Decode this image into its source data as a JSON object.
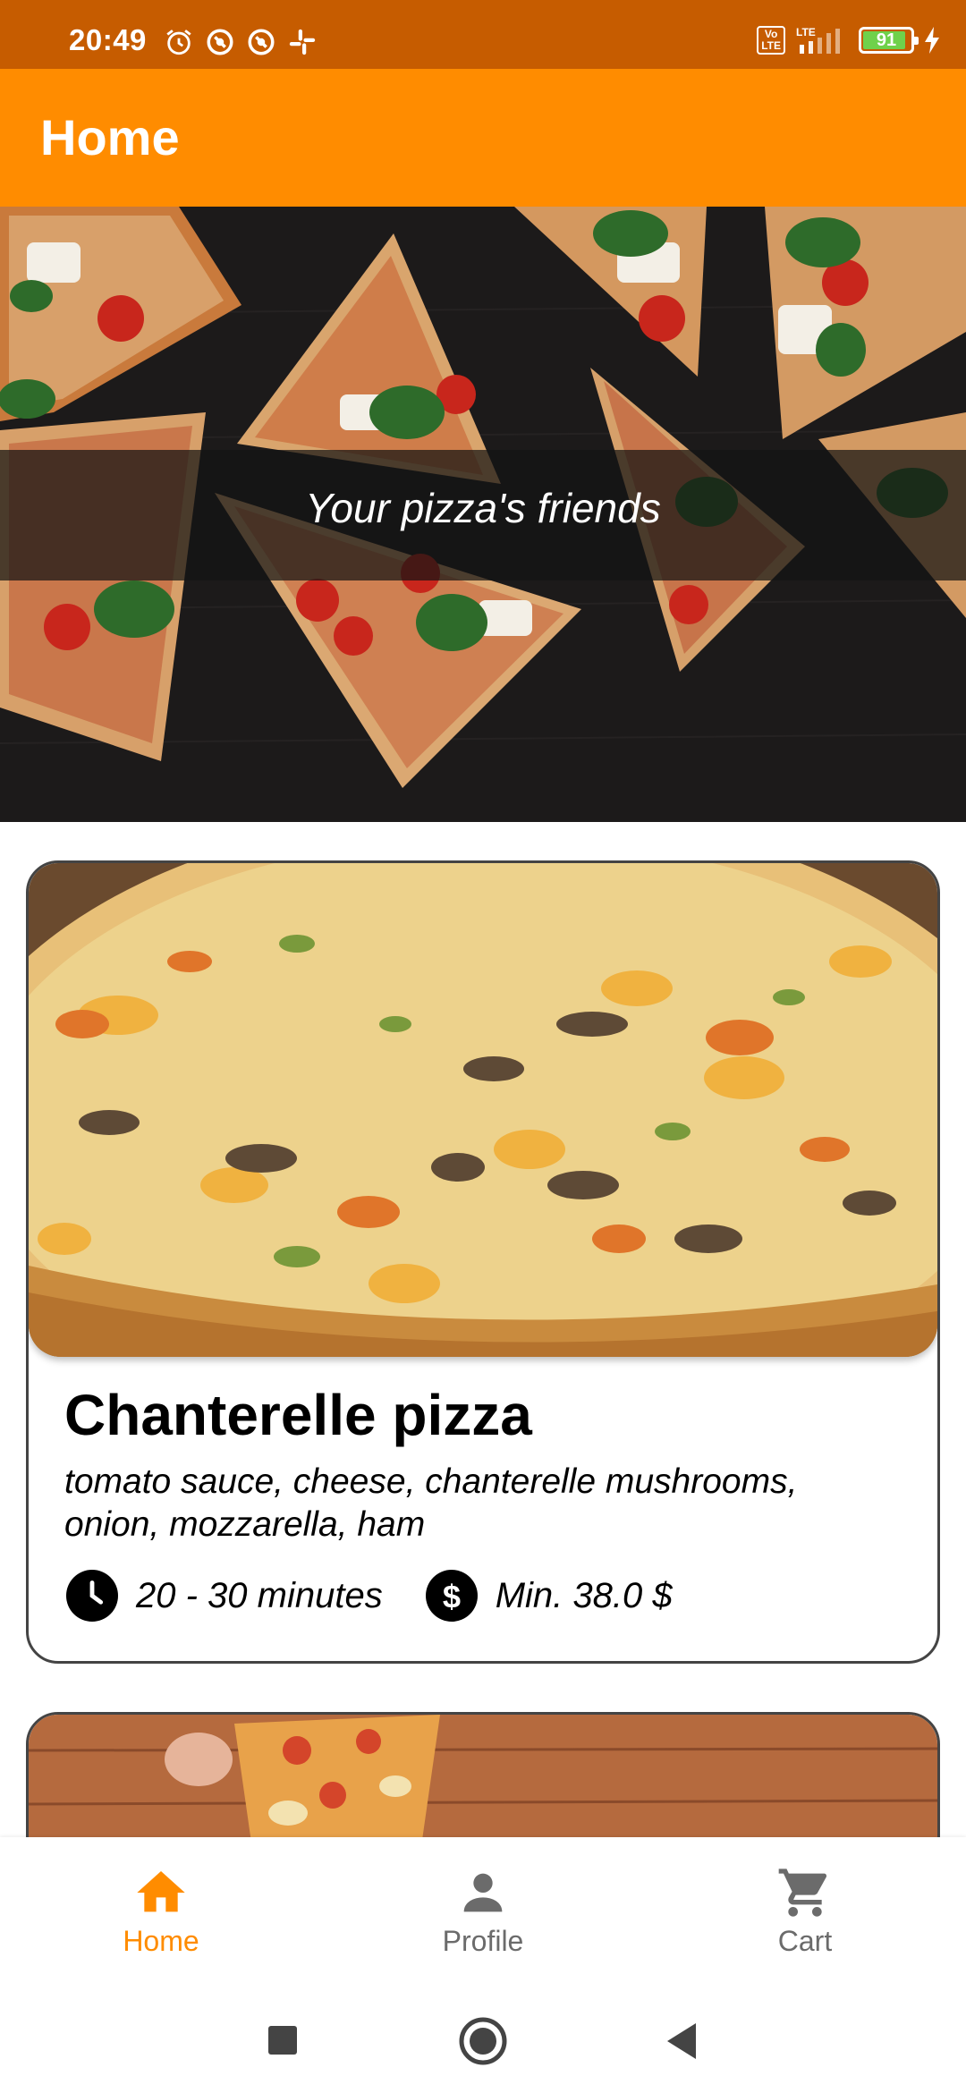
{
  "status_bar": {
    "time": "20:49",
    "left_icons": [
      "alarm-icon",
      "app-notification-icon",
      "app-notification-icon",
      "slack-icon"
    ],
    "network": "LTE",
    "volte": "Vo\nLTE",
    "battery": "91",
    "battery_level": 0.91
  },
  "app_bar": {
    "title": "Home"
  },
  "hero": {
    "tagline": "Your pizza's friends"
  },
  "cards": [
    {
      "title": "Chanterelle pizza",
      "description": "tomato sauce, cheese, chanterelle mushrooms, onion, mozzarella, ham",
      "time_icon": "clock-icon",
      "time": "20 - 30 minutes",
      "price_icon": "dollar-icon",
      "price": "Min. 38.0 $"
    }
  ],
  "bottom_nav": {
    "items": [
      {
        "label": "Home",
        "icon": "home-icon",
        "active": true
      },
      {
        "label": "Profile",
        "icon": "person-icon",
        "active": false
      },
      {
        "label": "Cart",
        "icon": "cart-icon",
        "active": false
      }
    ]
  },
  "colors": {
    "status_bar": "#c65c00",
    "primary": "#ff8c00",
    "inactive": "#6b6b6b"
  }
}
